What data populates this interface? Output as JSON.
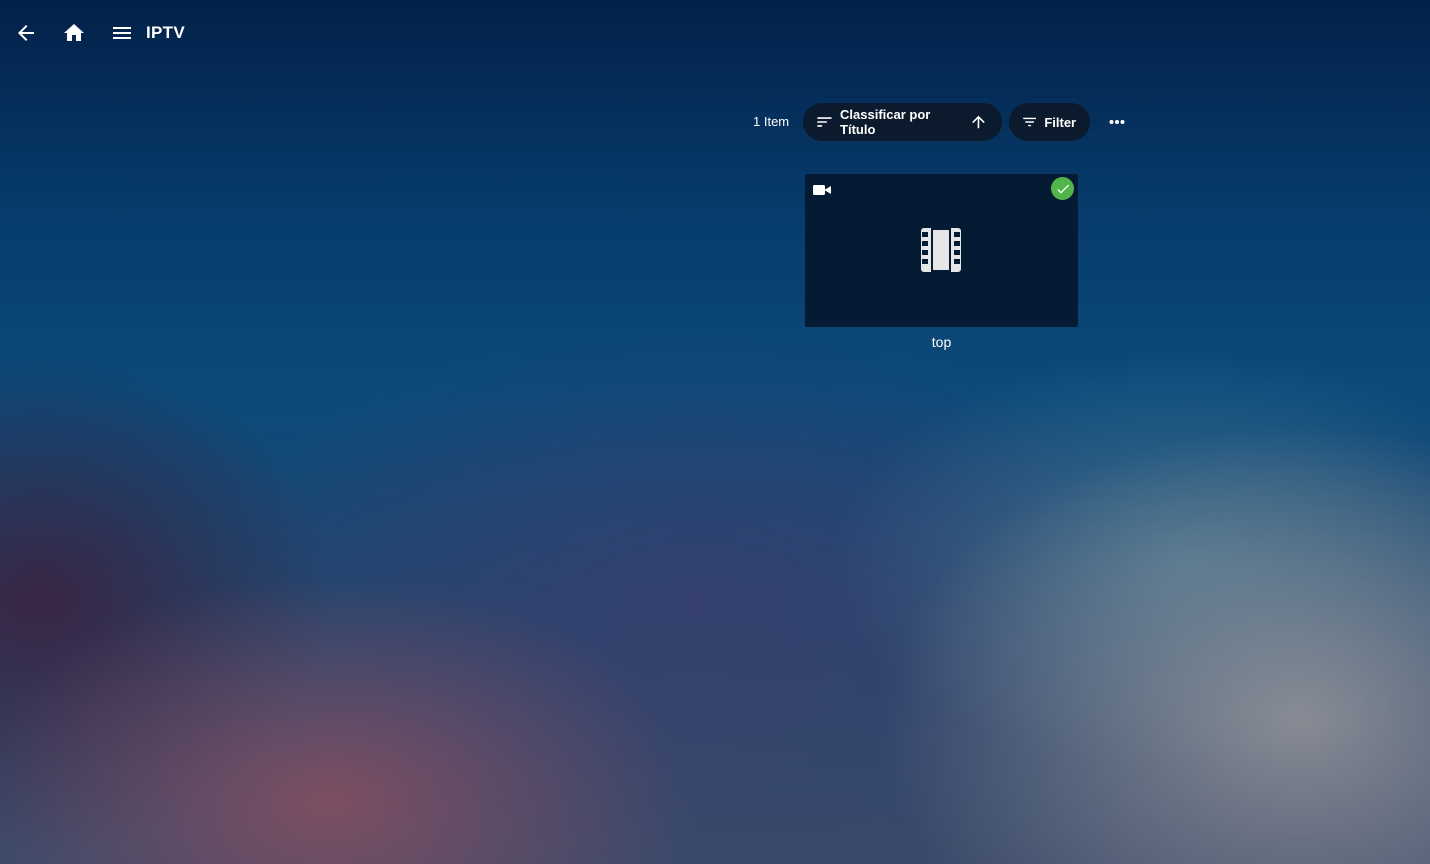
{
  "header": {
    "title": "IPTV",
    "icons": {
      "back": "arrow-left-icon",
      "home": "home-icon",
      "menu": "hamburger-menu-icon"
    }
  },
  "toolbar": {
    "item_count": "1 Item",
    "sort_label": "Classificar por Título",
    "filter_label": "Filter",
    "icons": {
      "sort": "sort-icon",
      "sort_direction": "arrow-up-icon",
      "filter": "filter-icon",
      "more": "more-horizontal-icon"
    }
  },
  "items": [
    {
      "title": "top",
      "played": true,
      "icons": {
        "type": "video-camera-icon",
        "status": "check-icon",
        "placeholder": "film-strip-icon"
      }
    }
  ],
  "colors": {
    "pill_background": "#0b1a2c",
    "card_background": "#041b33",
    "played_badge": "#52b54b",
    "text": "#ffffff"
  }
}
